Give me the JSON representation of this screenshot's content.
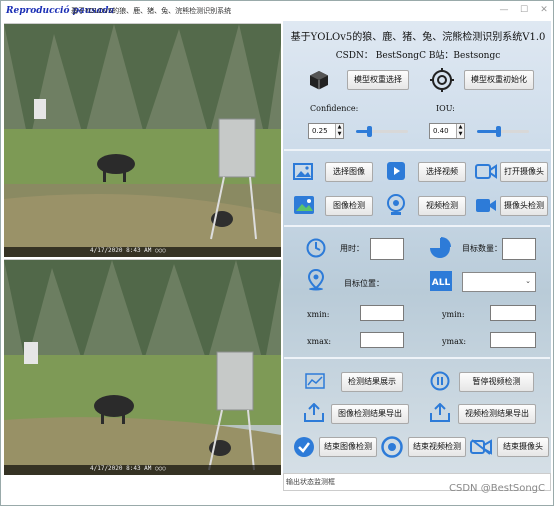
{
  "window": {
    "overlay_label": "Reproducció pausada",
    "title": "基于YOLOv5的狼、鹿、猪、兔、浣熊检测识别系统",
    "controls": [
      "—",
      "☐",
      "✕"
    ]
  },
  "left": {
    "top_timestamp": "4/17/2020  8:43 AM  ○○○",
    "bottom_timestamp": "4/17/2020  8:43 AM  ○○○"
  },
  "header": {
    "title": "基于YOLOv5的狼、鹿、猪、兔、浣熊检测识别系统V1.0",
    "subtitle": "CSDN：  BestSongC    B站：Bestsongc"
  },
  "model": {
    "select_label": "模型权重选择",
    "init_label": "模型权重初始化",
    "confidence_label": "Confidence:",
    "confidence_value": "0.25",
    "confidence_level": 0.25,
    "iou_label": "IOU:",
    "iou_value": "0.40",
    "iou_level": 0.4
  },
  "actions": {
    "select_image": "选择图像",
    "select_video": "选择视频",
    "open_camera": "打开摄像头",
    "detect_image": "图像检测",
    "detect_video": "视频检测",
    "detect_camera": "摄像头检测"
  },
  "stats": {
    "time_label": "用时：",
    "time_value": "",
    "count_label": "目标数量：",
    "count_value": "",
    "position_label": "目标位置：",
    "class_selected": "",
    "xmin_label": "xmin:",
    "xmin_value": "",
    "ymin_label": "ymin:",
    "ymin_value": "",
    "xmax_label": "xmax:",
    "xmax_value": "",
    "ymax_label": "ymax:",
    "ymax_value": ""
  },
  "results": {
    "show_results": "检测结果展示",
    "pause_video": "暂停视频检测",
    "export_image": "图像检测结果导出",
    "export_video": "视频检测结果导出",
    "end_image": "结束图像检测",
    "end_video": "结束视频检测",
    "end_camera": "结束摄像头"
  },
  "status": {
    "placeholder": "输出状态监测框"
  },
  "watermark": "CSDN @BestSongC",
  "colors": {
    "accent": "#2d7bd8",
    "panel_bg": "#c9d9e8"
  }
}
